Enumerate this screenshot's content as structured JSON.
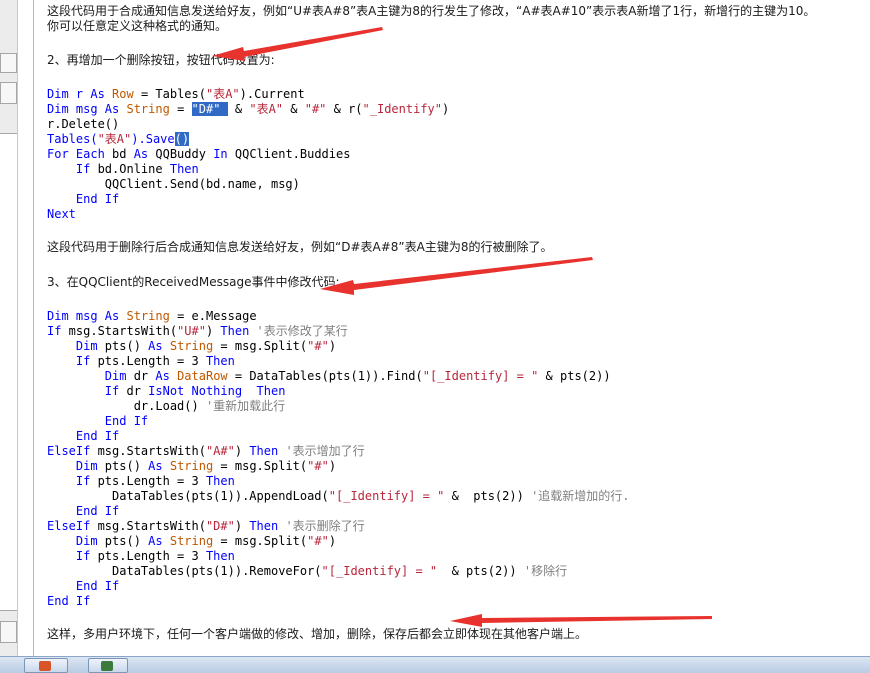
{
  "document": {
    "intro_line1": "这段代码用于合成通知信息发送给好友，例如“U#表A#8”表A主键为8的行发生了修改，“A#表A#10”表示表A新增了1行，新增行的主键为10。",
    "intro_line2": "你可以任意定义这种格式的通知。",
    "step2_heading": "2、再增加一个删除按钮，按钮代码设置为:",
    "code2": {
      "l1_kw1": "Dim r ",
      "l1_kw2": "As ",
      "l1_ty": "Row",
      "l1_rest1": " = Tables(",
      "l1_st": "\"表A\"",
      "l1_rest2": ").Current",
      "l2_kw1": "Dim msg ",
      "l2_kw2": "As ",
      "l2_ty": "String",
      "l2_rest1": " = ",
      "l2_sel": "\"D#\" ",
      "l2_rest2": " & ",
      "l2_st2": "\"表A\"",
      "l2_rest3": " & ",
      "l2_st3": "\"#\"",
      "l2_rest4": " & r(",
      "l2_st4": "\"_Identify\"",
      "l2_rest5": ")",
      "l3": "r.Delete()",
      "l4_a": "Tables(",
      "l4_st": "\"表A\"",
      "l4_b": ").Save",
      "l4_sel": "()",
      "l5_kw": "For Each",
      "l5_a": " bd ",
      "l5_kw2": "As",
      "l5_b": " QQBuddy ",
      "l5_kw3": "In",
      "l5_c": " QQClient.Buddies",
      "l6_kw": "    If",
      "l6_a": " bd.Online ",
      "l6_kw2": "Then",
      "l7": "        QQClient.Send(bd.name, msg)",
      "l8": "    End If",
      "l9": "Next"
    },
    "after_code2": "这段代码用于删除行后合成通知信息发送给好友，例如“D#表A#8”表A主键为8的行被删除了。",
    "step3_heading": "3、在QQClient的ReceivedMessage事件中修改代码:",
    "code3": {
      "l1_kw": "Dim msg ",
      "l1_kw2": "As ",
      "l1_ty": "String",
      "l1_rest": " = e.Message",
      "l2_kw": "If",
      "l2_a": " msg.StartsWith(",
      "l2_st": "\"U#\"",
      "l2_b": ") ",
      "l2_kw2": "Then",
      "l2_cm": " '表示修改了某行",
      "l3_kw": "    Dim",
      "l3_a": " pts() ",
      "l3_kw2": "As ",
      "l3_ty": "String",
      "l3_b": " = msg.Split(",
      "l3_st": "\"#\"",
      "l3_c": ")",
      "l4_kw": "    If",
      "l4_a": " pts.Length = 3 ",
      "l4_kw2": "Then",
      "l5_kw": "        Dim",
      "l5_a": " dr ",
      "l5_kw2": "As ",
      "l5_ty": "DataRow",
      "l5_b": " = DataTables(pts(1)).Find(",
      "l5_st": "\"[_Identify] = \"",
      "l5_c": " & pts(2))",
      "l6_kw": "        If",
      "l6_a": " dr ",
      "l6_kw2": "IsNot Nothing",
      "l6_b": "  ",
      "l6_kw3": "Then",
      "l7_a": "            dr.Load() ",
      "l7_cm": "'重新加载此行",
      "l8": "        End If",
      "l9": "    End If",
      "l10_kw": "ElseIf",
      "l10_a": " msg.StartsWith(",
      "l10_st": "\"A#\"",
      "l10_b": ") ",
      "l10_kw2": "Then",
      "l10_cm": " '表示增加了行",
      "l11_kw": "    Dim",
      "l11_a": " pts() ",
      "l11_kw2": "As ",
      "l11_ty": "String",
      "l11_b": " = msg.Split(",
      "l11_st": "\"#\"",
      "l11_c": ")",
      "l12_kw": "    If",
      "l12_a": " pts.Length = 3 ",
      "l12_kw2": "Then",
      "l13_a": "         DataTables(pts(1)).AppendLoad(",
      "l13_st": "\"[_Identify] = \"",
      "l13_b": " &  pts(2)) ",
      "l13_cm": "'追载新增加的行.",
      "l14": "    End If",
      "l15_kw": "ElseIf",
      "l15_a": " msg.StartsWith(",
      "l15_st": "\"D#\"",
      "l15_b": ") ",
      "l15_kw2": "Then",
      "l15_cm": " '表示删除了行",
      "l16_kw": "    Dim",
      "l16_a": " pts() ",
      "l16_kw2": "As ",
      "l16_ty": "String",
      "l16_b": " = msg.Split(",
      "l16_st": "\"#\"",
      "l16_c": ")",
      "l17_kw": "    If",
      "l17_a": " pts.Length = 3 ",
      "l17_kw2": "Then",
      "l18_a": "         DataTables(pts(1)).RemoveFor(",
      "l18_st": "\"[_Identify] = \"",
      "l18_b": "  & pts(2)) ",
      "l18_cm": "'移除行",
      "l19": "    End If",
      "l20": "End If"
    },
    "conclusion": "这样，多用户环境下，任何一个客户端做的修改、增加，删除，保存后都会立即体现在其他客户端上。"
  },
  "colors": {
    "keyword": "#0000ff",
    "type": "#c05800",
    "string": "#b8263b",
    "comment": "#808080",
    "selection": "#316ac5",
    "annotation_arrow": "#e8322e"
  },
  "taskbar": {
    "icons": [
      "app-icon",
      "window-icon"
    ]
  }
}
